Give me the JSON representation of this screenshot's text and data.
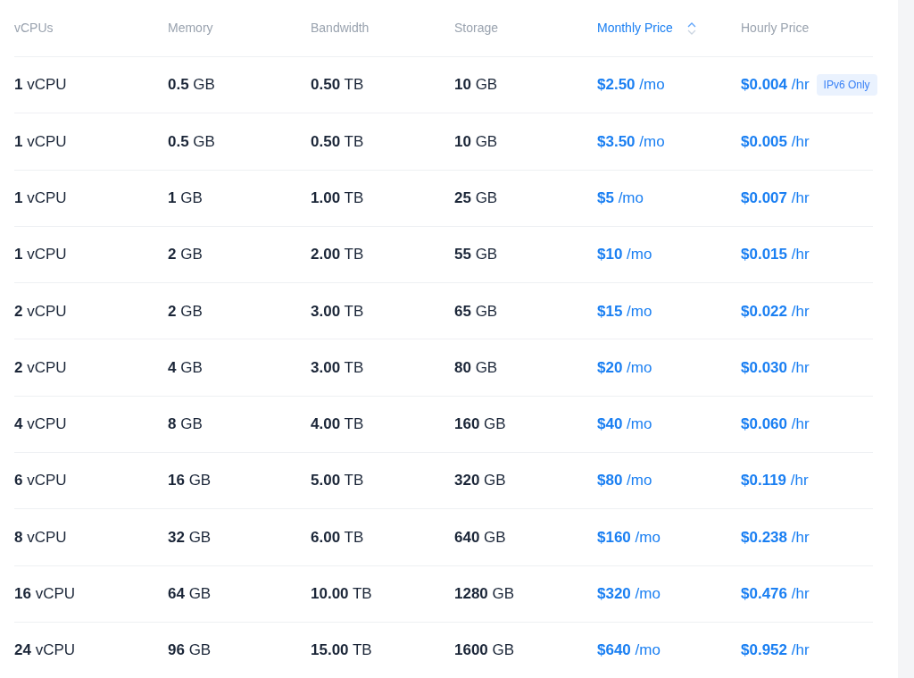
{
  "columns": [
    {
      "label": "vCPUs",
      "selected": false
    },
    {
      "label": "Memory",
      "selected": false
    },
    {
      "label": "Bandwidth",
      "selected": false
    },
    {
      "label": "Storage",
      "selected": false
    },
    {
      "label": "Monthly Price",
      "selected": true
    },
    {
      "label": "Hourly Price",
      "selected": false
    }
  ],
  "rows": [
    {
      "cells": [
        "**1** vCPU",
        "**0.5** GB",
        "**0.50** TB",
        "**10** GB",
        "**$2.50** /mo",
        "**$0.004** /hr"
      ],
      "badge": "IPv6 Only"
    },
    {
      "cells": [
        "**1** vCPU",
        "**0.5** GB",
        "**0.50** TB",
        "**10** GB",
        "**$3.50** /mo",
        "**$0.005** /hr"
      ]
    },
    {
      "cells": [
        "**1** vCPU",
        "**1** GB",
        "**1.00** TB",
        "**25** GB",
        "**$5** /mo",
        "**$0.007** /hr"
      ]
    },
    {
      "cells": [
        "**1** vCPU",
        "**2** GB",
        "**2.00** TB",
        "**55** GB",
        "**$10** /mo",
        "**$0.015** /hr"
      ]
    },
    {
      "cells": [
        "**2** vCPU",
        "**2** GB",
        "**3.00** TB",
        "**65** GB",
        "**$15** /mo",
        "**$0.022** /hr"
      ]
    },
    {
      "cells": [
        "**2** vCPU",
        "**4** GB",
        "**3.00** TB",
        "**80** GB",
        "**$20** /mo",
        "**$0.030** /hr"
      ]
    },
    {
      "cells": [
        "**4** vCPU",
        "**8** GB",
        "**4.00** TB",
        "**160** GB",
        "**$40** /mo",
        "**$0.060** /hr"
      ]
    },
    {
      "cells": [
        "**6** vCPU",
        "**16** GB",
        "**5.00** TB",
        "**320** GB",
        "**$80** /mo",
        "**$0.119** /hr"
      ]
    },
    {
      "cells": [
        "**8** vCPU",
        "**32** GB",
        "**6.00** TB",
        "**640** GB",
        "**$160** /mo",
        "**$0.238** /hr"
      ]
    },
    {
      "cells": [
        "**16** vCPU",
        "**64** GB",
        "**10.00** TB",
        "**1280** GB",
        "**$320** /mo",
        "**$0.476** /hr"
      ]
    },
    {
      "cells": [
        "**24** vCPU",
        "**96** GB",
        "**15.00** TB",
        "**1600** GB",
        "**$640** /mo",
        "**$0.952** /hr"
      ]
    }
  ]
}
